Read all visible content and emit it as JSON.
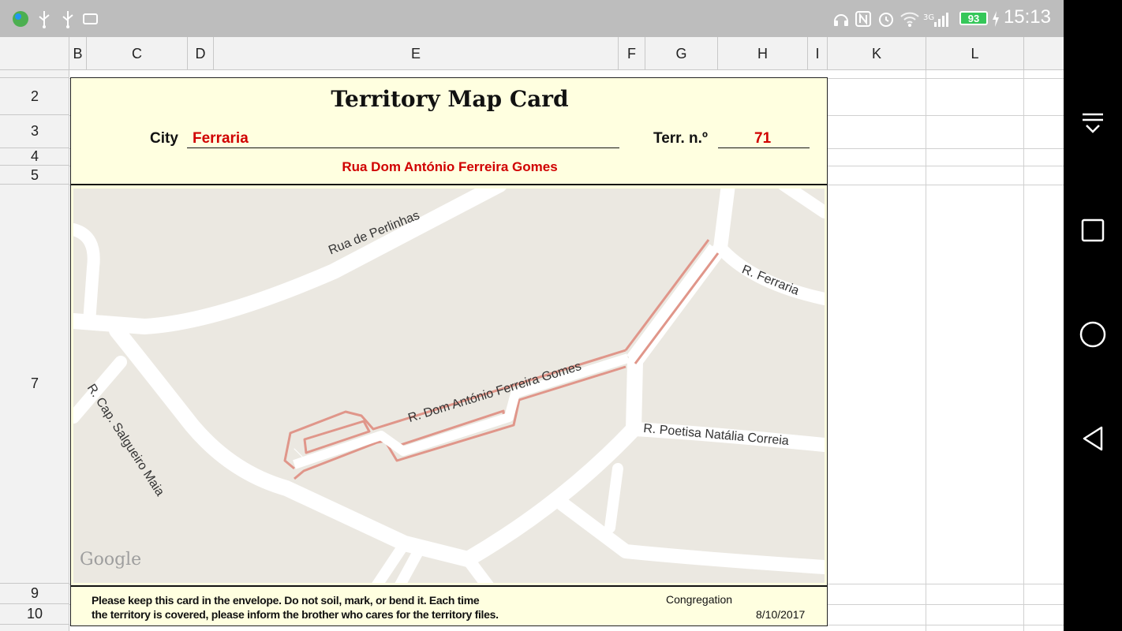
{
  "status_bar": {
    "time": "15:13",
    "battery": "93",
    "network": "3G",
    "icons": [
      "globe-app-icon",
      "usb-icon",
      "usb-icon",
      "screen-cast-icon",
      "headset-icon",
      "nfc-icon",
      "alarm-icon",
      "wifi-icon",
      "signal-icon",
      "battery-icon",
      "charging-icon"
    ]
  },
  "nav_bar": {
    "icons": [
      "notification-pull-icon",
      "recents-icon",
      "home-icon",
      "back-icon"
    ]
  },
  "sheet": {
    "columns": [
      "B",
      "C",
      "D",
      "E",
      "F",
      "G",
      "H",
      "I",
      "K",
      "L"
    ],
    "rows": [
      "2",
      "3",
      "4",
      "5",
      "7",
      "9",
      "10"
    ]
  },
  "card": {
    "title": "Territory Map Card",
    "city_label": "City",
    "city_value": "Ferraria",
    "terr_label": "Terr. n.º",
    "terr_value": "71",
    "street": "Rua Dom António Ferreira Gomes",
    "map": {
      "streets": [
        "Rua de Perlinhas",
        "R. Ferraria",
        "R. Cap. Salgueiro Maia",
        "R. Dom António Ferreira Gomes",
        "R. Poetisa Natália Correia"
      ],
      "attribution": "Google"
    },
    "footer_line1": "Please keep this card in the envelope. Do not soil, mark, or bend it. Each time",
    "footer_line2": "the territory is covered, please inform the brother who cares for the territory files.",
    "congregation_label": "Congregation",
    "date": "8/10/2017"
  },
  "colors": {
    "status_bar": "#bdbdbd",
    "card_bg": "#ffffe0",
    "value_red": "#d00000",
    "map_land": "#ebe8e1",
    "route": "#e0968a"
  }
}
